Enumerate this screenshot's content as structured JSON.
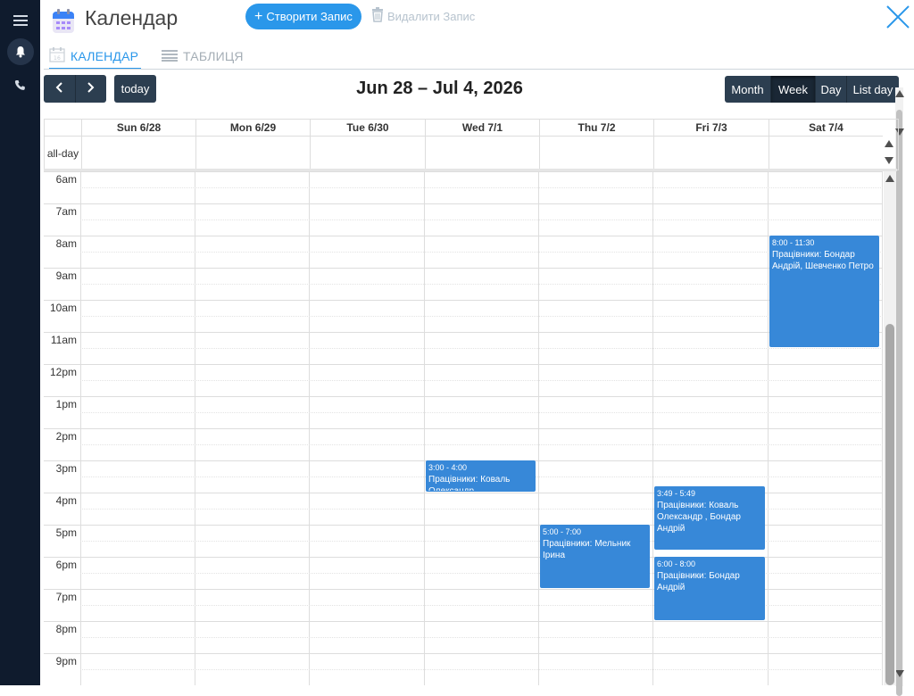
{
  "app": {
    "title": "Календар"
  },
  "toolbar": {
    "create_label": "Створити Запис",
    "delete_label": "Видалити Запис"
  },
  "tabs": [
    {
      "label": "КАЛЕНДАР"
    },
    {
      "label": "ТАБЛИЦЯ"
    }
  ],
  "calendar": {
    "range_title": "Jun 28 – Jul 4, 2026",
    "today_label": "today",
    "views": [
      {
        "label": "Month"
      },
      {
        "label": "Week"
      },
      {
        "label": "Day"
      },
      {
        "label": "List day"
      }
    ],
    "active_view": "Week",
    "allday_label": "all-day",
    "days": [
      "Sun 6/28",
      "Mon 6/29",
      "Tue 6/30",
      "Wed 7/1",
      "Thu 7/2",
      "Fri 7/3",
      "Sat 7/4"
    ],
    "hours": [
      "6am",
      "7am",
      "8am",
      "9am",
      "10am",
      "11am",
      "12pm",
      "1pm",
      "2pm",
      "3pm",
      "4pm",
      "5pm",
      "6pm",
      "7pm",
      "8pm",
      "9pm"
    ],
    "first_hour": 6,
    "events": [
      {
        "day": 6,
        "start": 8.0,
        "end": 11.5,
        "time": "8:00 - 11:30",
        "text": "Працівники: Бондар Андрій, Шевченко Петро"
      },
      {
        "day": 3,
        "start": 15.0,
        "end": 16.0,
        "time": "3:00 - 4:00",
        "text": "Працівники: Коваль Олександр"
      },
      {
        "day": 5,
        "start": 15.8167,
        "end": 17.8167,
        "time": "3:49 - 5:49",
        "text": "Працівники: Коваль Олександр , Бондар Андрій"
      },
      {
        "day": 4,
        "start": 17.0,
        "end": 19.0,
        "time": "5:00 - 7:00",
        "text": "Працівники: Мельник Ірина"
      },
      {
        "day": 5,
        "start": 18.0,
        "end": 20.0,
        "time": "6:00 - 8:00",
        "text": "Працівники: Бондар Андрій"
      }
    ]
  },
  "colors": {
    "sidebar": "#0f1b2d",
    "accent": "#2a97ea",
    "event": "#3788d8",
    "toolbar_button": "#2c3e50"
  },
  "icons": {
    "menu": "menu-icon",
    "bell": "bell-icon",
    "phone": "phone-icon",
    "calendar": "calendar-icon",
    "table": "table-icon",
    "trash": "trash-icon",
    "close": "close-icon",
    "plus": "plus-icon"
  }
}
